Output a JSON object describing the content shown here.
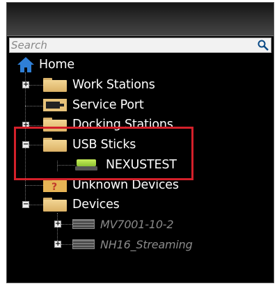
{
  "search": {
    "placeholder": "Search"
  },
  "tree": {
    "root_label": "Home",
    "items": [
      {
        "label": "Work Stations"
      },
      {
        "label": "Service Port"
      },
      {
        "label": "Docking Stations"
      },
      {
        "label": "USB Sticks"
      },
      {
        "label": "NEXUSTEST"
      },
      {
        "label": "Unknown Devices"
      },
      {
        "label": "Devices"
      },
      {
        "label": "MV7001-10-2"
      },
      {
        "label": "NH16_Streaming"
      }
    ]
  },
  "colors": {
    "highlight": "#d4202a",
    "folder": "#e8c27a",
    "usb_stick": "#a8d84a"
  }
}
